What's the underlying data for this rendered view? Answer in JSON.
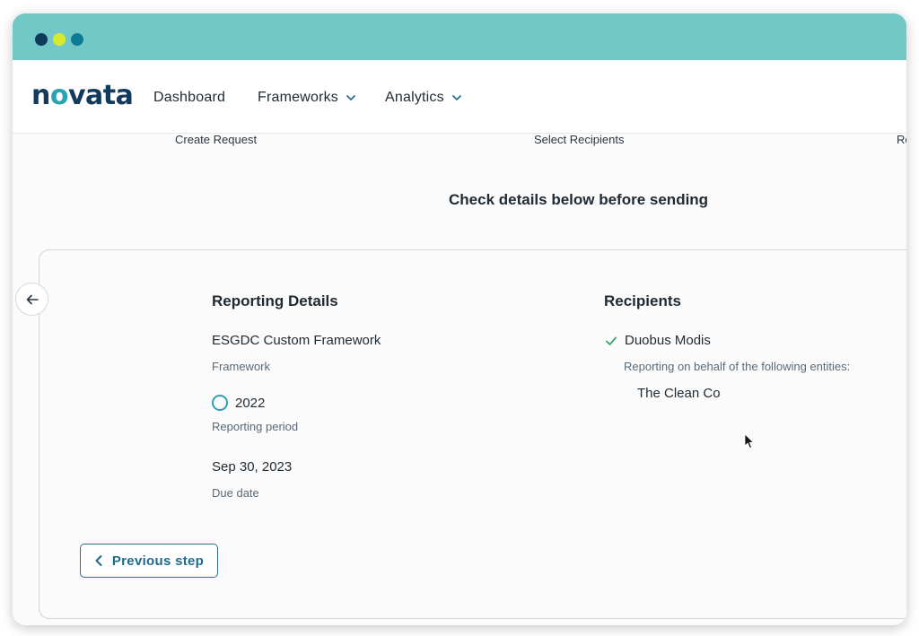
{
  "window": {
    "controls": [
      "close",
      "minimize",
      "maximize"
    ],
    "colors": {
      "titlebar": "#72c7c7",
      "close": "#0f3b5a",
      "minimize": "#d8eb2a",
      "maximize": "#0f7a93"
    }
  },
  "nav": {
    "logo_prefix": "n",
    "logo_o": "o",
    "logo_suffix": "vata",
    "items": [
      {
        "label": "Dashboard",
        "dropdown": false
      },
      {
        "label": "Frameworks",
        "dropdown": true
      },
      {
        "label": "Analytics",
        "dropdown": true
      }
    ]
  },
  "steps": [
    "Create Request",
    "Select Recipients",
    "Re"
  ],
  "heading": "Check details below before sending",
  "reporting": {
    "title": "Reporting Details",
    "framework_value": "ESGDC Custom Framework",
    "framework_label": "Framework",
    "period_value": "2022",
    "period_label": "Reporting period",
    "due_value": "Sep 30, 2023",
    "due_label": "Due date"
  },
  "recipients": {
    "title": "Recipients",
    "name": "Duobus Modis",
    "behalf_label": "Reporting on behalf of the following entities:",
    "entities": [
      "The Clean Co"
    ]
  },
  "actions": {
    "previous_label": "Previous step"
  },
  "icons": {
    "back": "arrow-left-icon",
    "chevron": "chevron-down-icon",
    "check": "check-icon",
    "period": "circle-outline-icon",
    "prev": "chevron-left-icon"
  },
  "accent_color": "#2aa3b2"
}
